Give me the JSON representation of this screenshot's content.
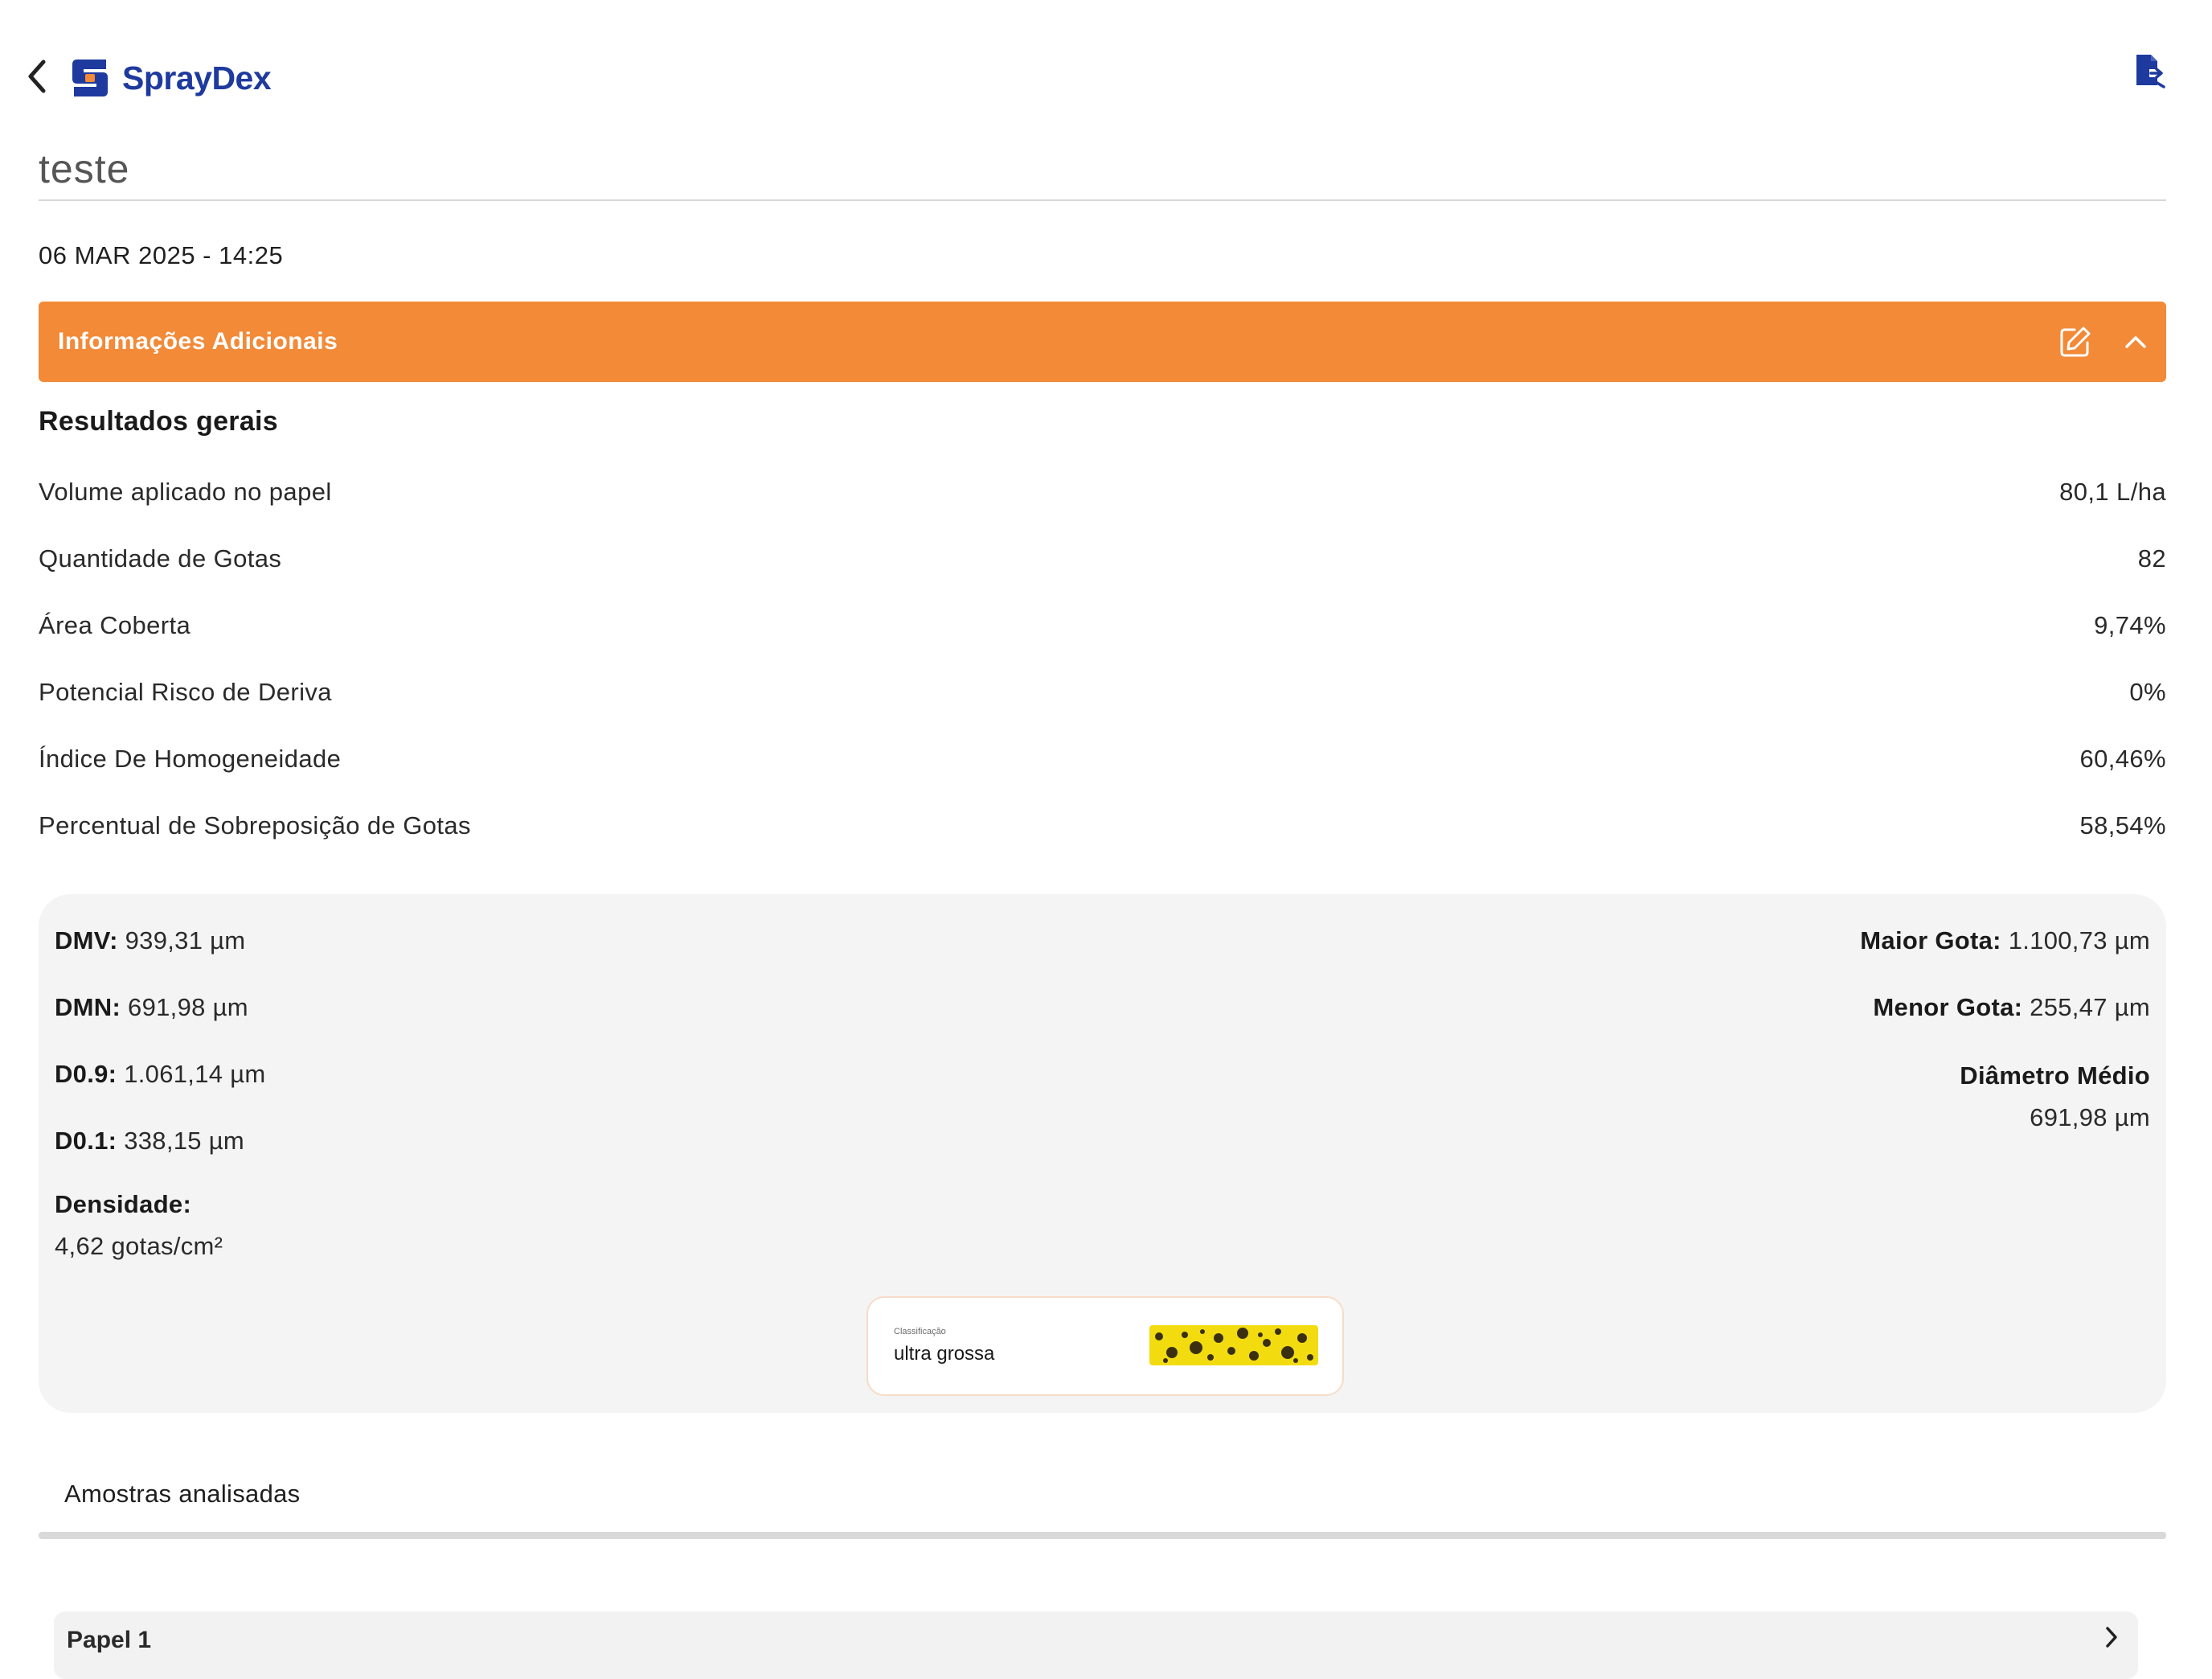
{
  "header": {
    "brand_name": "SprayDex"
  },
  "record": {
    "title": "teste",
    "datetime": "06 MAR 2025 - 14:25"
  },
  "banner": {
    "label": "Informações Adicionais"
  },
  "results": {
    "title": "Resultados gerais",
    "rows": [
      {
        "label": "Volume aplicado no papel",
        "value": "80,1 L/ha"
      },
      {
        "label": "Quantidade de Gotas",
        "value": "82"
      },
      {
        "label": "Área Coberta",
        "value": "9,74%"
      },
      {
        "label": "Potencial Risco de Deriva",
        "value": "0%"
      },
      {
        "label": "Índice De Homogeneidade",
        "value": "60,46%"
      },
      {
        "label": "Percentual de Sobreposição de Gotas",
        "value": "58,54%"
      }
    ]
  },
  "stats": {
    "dmv": {
      "label": "DMV:",
      "value": " 939,31 µm"
    },
    "dmn": {
      "label": "DMN:",
      "value": " 691,98 µm"
    },
    "d09": {
      "label": "D0.9:",
      "value": " 1.061,14 µm"
    },
    "d01": {
      "label": "D0.1:",
      "value": " 338,15  µm"
    },
    "densidade": {
      "label": "Densidade:",
      "value": "4,62 gotas/cm²"
    },
    "maior_gota": {
      "label": "Maior Gota:",
      "value": " 1.100,73 µm"
    },
    "menor_gota": {
      "label": "Menor Gota:",
      "value": " 255,47 µm"
    },
    "diametro_medio": {
      "label": "Diâmetro Médio",
      "value": "691,98 µm"
    }
  },
  "classification": {
    "caption": "Classificação",
    "value": "ultra grossa",
    "swatch_color": "#f2dc10"
  },
  "samples": {
    "title": "Amostras analisadas",
    "items": [
      {
        "label": "Papel 1"
      }
    ]
  },
  "colors": {
    "brand_blue": "#1e3a9e",
    "brand_orange": "#f28a38",
    "card_bg": "#f4f4f4"
  },
  "icons": {
    "back": "chevron-left-icon",
    "export": "file-export-icon",
    "edit": "edit-icon",
    "collapse": "chevron-up-icon",
    "sample_open": "chevron-right-icon"
  }
}
